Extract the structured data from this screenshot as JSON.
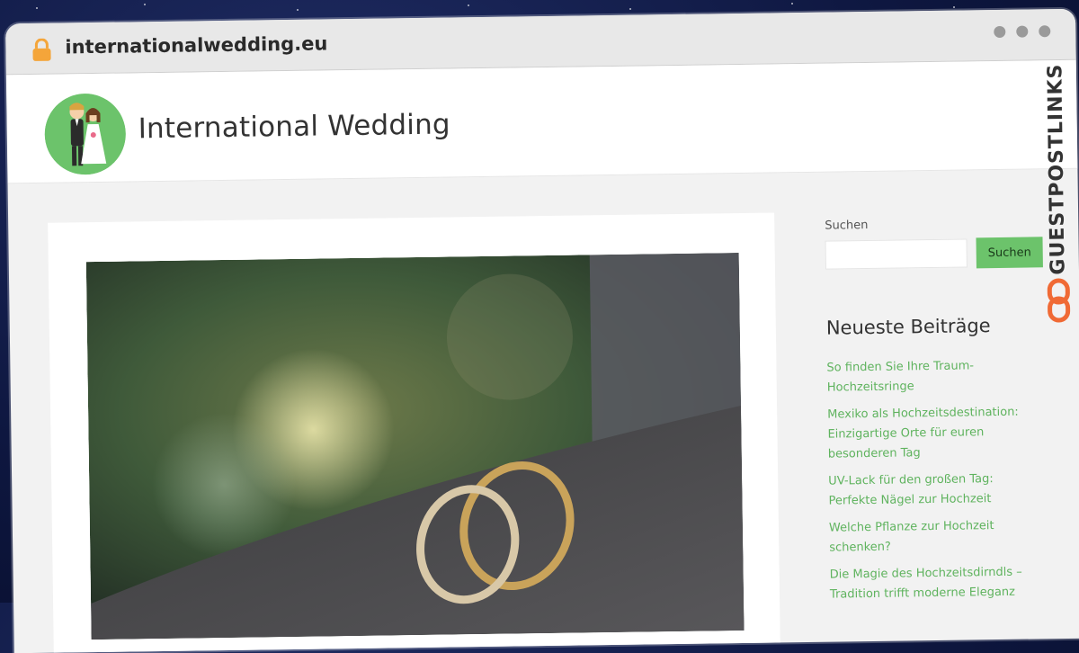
{
  "browser": {
    "url": "internationalwedding.eu"
  },
  "site": {
    "title": "International Wedding"
  },
  "sidebar": {
    "search_label": "Suchen",
    "search_placeholder": "",
    "search_button": "Suchen",
    "recent_title": "Neueste Beiträge",
    "recent_posts": [
      "So finden Sie Ihre Traum-Hochzeitsringe",
      "Mexiko als Hochzeitsdestination: Einzigartige Orte für euren besonderen Tag",
      "UV-Lack für den großen Tag: Perfekte Nägel zur Hochzeit",
      "Welche Pflanze zur Hochzeit schenken?",
      "Die Magie des Hochzeitsdirndls – Tradition trifft moderne Eleganz"
    ]
  },
  "badge": {
    "text": "GUESTPOSTLINKS"
  },
  "colors": {
    "accent_green": "#6cc36b",
    "link_green": "#5fb35e",
    "badge_orange": "#f06a35"
  }
}
